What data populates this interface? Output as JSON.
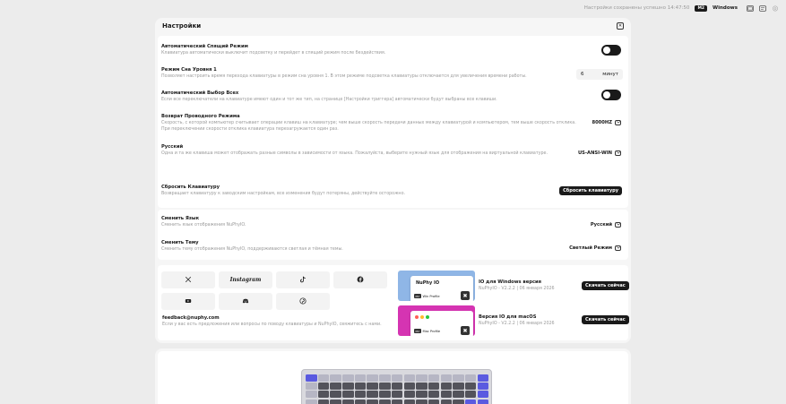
{
  "topbar": {
    "save_status": "Настройки сохранены успешно 14:47:50",
    "model_badge": "M2",
    "os_label": "Windows"
  },
  "panel": {
    "title": "Настройки"
  },
  "settings": [
    {
      "title": "Автоматический Спящий Режим",
      "desc": "Клавиатура автоматически выключит подсветку и перейдет в спящий режим после бездействия."
    },
    {
      "title": "Режим Сна Уровня 1",
      "desc": "Позволяет настроить время перехода клавиатуры в режим сна уровня 1. В этом режиме подсветка клавиатуры отключается для увеличения времени работы.",
      "value": "6",
      "unit": "минут"
    },
    {
      "title": "Автоматический Выбор Всех",
      "desc": "Если все переключатели на клавиатуре имеют один и тот же тип, на странице [Настройки триггера] автоматически будут выбраны все клавиши."
    },
    {
      "title": "Возврат Проводного Режима",
      "desc": "Скорость, с которой компьютер считывает операции клавиш на клавиатуре; чем выше скорость передачи данных между клавиатурой и компьютером, тем выше скорость отклика. При переключении скорости отклика клавиатура перезагружается один раз.",
      "value": "8000HZ"
    },
    {
      "title": "Русский",
      "desc": "Одна и та же клавиша может отображать разные символы в зависимости от языка. Пожалуйста, выберите нужный язык для отображения на виртуальной клавиатуре.",
      "value": "US-ANSI-WIN"
    }
  ],
  "reset": {
    "title": "Сбросить Клавиатуру",
    "desc": "Возвращает клавиатуру к заводским настройкам, все изменения будут потеряны, действуйте осторожно.",
    "button": "Сбросить клавиатуру"
  },
  "language": {
    "title": "Сменить Язык",
    "desc": "Сменить язык отображения NuPhyIO.",
    "value": "Русский"
  },
  "theme": {
    "title": "Сменить Тему",
    "desc": "Сменить тему отображения NuPhyIO, поддерживаются светлая и тёмная темы.",
    "value": "Светлый Режим"
  },
  "social": {
    "items": [
      {
        "name": "x-icon"
      },
      {
        "name": "instagram-icon",
        "text": "Instagram"
      },
      {
        "name": "tiktok-icon"
      },
      {
        "name": "facebook-icon"
      },
      {
        "name": "youtube-icon"
      },
      {
        "name": "discord-icon"
      },
      {
        "name": "pinterest-icon"
      }
    ],
    "email": "feedback@nuphy.com",
    "desc": "Если у вас есть предложения или вопросы по поводу клавиатуры и NuPhyIO, свяжитесь с нами."
  },
  "apps": [
    {
      "thumb_name": "NuPhy IO",
      "thumb_tag": "Win Profile",
      "title": "IO для Windows версия",
      "meta": "NuPhyIO - V2.2.2 | 06 января 2026",
      "button": "Скачать сейчас",
      "color": "#8fb6e6"
    },
    {
      "thumb_tag": "Mac Profile",
      "title": "Версия IO для macOS",
      "meta": "NuPhyIO - V2.2.2 | 06 января 2026",
      "button": "Скачать сейчас",
      "color": "#d534b2"
    }
  ],
  "colors": {
    "accent_dark": "#1a1a1a",
    "keycap_blue": "#5a5ae0"
  }
}
